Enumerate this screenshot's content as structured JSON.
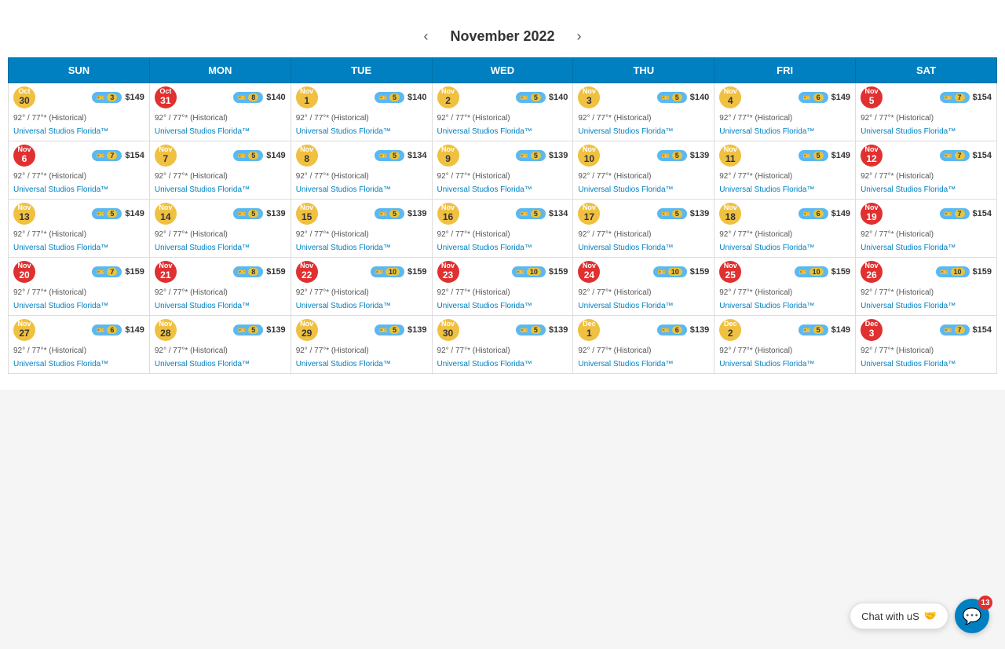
{
  "calendar": {
    "title": "November 2022",
    "days_of_week": [
      "SUN",
      "MON",
      "TUE",
      "WED",
      "THU",
      "FRI",
      "SAT"
    ],
    "prev_label": "‹",
    "next_label": "›"
  },
  "rows": [
    {
      "cells": [
        {
          "month": "Oct",
          "day": "30",
          "crowd": 3,
          "crowd_color": "yellow",
          "ticket": true,
          "price": "$149",
          "weather": "92° / 77°* (Historical)",
          "link": "Universal Studios Florida™",
          "highlight": false
        },
        {
          "month": "Oct",
          "day": "31",
          "crowd": 8,
          "crowd_color": "red",
          "ticket": true,
          "price": "$140",
          "weather": "92° / 77°* (Historical)",
          "link": "Universal Studios Florida™",
          "highlight": false
        },
        {
          "month": "Nov",
          "day": "1",
          "crowd": 5,
          "crowd_color": "yellow",
          "ticket": true,
          "price": "$140",
          "weather": "92° / 77°* (Historical)",
          "link": "Universal Studios Florida™",
          "highlight": false
        },
        {
          "month": "Nov",
          "day": "2",
          "crowd": 5,
          "crowd_color": "yellow",
          "ticket": true,
          "price": "$140",
          "weather": "92° / 77°* (Historical)",
          "link": "Universal Studios Florida™",
          "highlight": false
        },
        {
          "month": "Nov",
          "day": "3",
          "crowd": 5,
          "crowd_color": "yellow",
          "ticket": true,
          "price": "$140",
          "weather": "92° / 77°* (Historical)",
          "link": "Universal Studios Florida™",
          "highlight": true
        },
        {
          "month": "Nov",
          "day": "4",
          "crowd": 6,
          "crowd_color": "yellow",
          "ticket": true,
          "price": "$149",
          "weather": "92° / 77°* (Historical)",
          "link": "Universal Studios Florida™",
          "highlight": false
        },
        {
          "month": "Nov",
          "day": "5",
          "crowd": 7,
          "crowd_color": "red",
          "ticket": true,
          "price": "$154",
          "weather": "92° / 77°* (Historical)",
          "link": "Universal Studios Florida™",
          "highlight": false
        }
      ]
    },
    {
      "cells": [
        {
          "month": "Nov",
          "day": "6",
          "crowd": 7,
          "crowd_color": "red",
          "ticket": true,
          "price": "$154",
          "weather": "92° / 77°* (Historical)",
          "link": "Universal Studios Florida™",
          "highlight": false
        },
        {
          "month": "Nov",
          "day": "7",
          "crowd": 5,
          "crowd_color": "yellow",
          "ticket": true,
          "price": "$149",
          "weather": "92° / 77°* (Historical)",
          "link": "Universal Studios Florida™",
          "highlight": false
        },
        {
          "month": "Nov",
          "day": "8",
          "crowd": 5,
          "crowd_color": "yellow",
          "ticket": true,
          "price": "$134",
          "weather": "92° / 77°* (Historical)",
          "link": "Universal Studios Florida™",
          "highlight": false
        },
        {
          "month": "Nov",
          "day": "9",
          "crowd": 5,
          "crowd_color": "yellow",
          "ticket": true,
          "price": "$139",
          "weather": "92° / 77°* (Historical)",
          "link": "Universal Studios Florida™",
          "highlight": false
        },
        {
          "month": "Nov",
          "day": "10",
          "crowd": 5,
          "crowd_color": "yellow",
          "ticket": true,
          "price": "$139",
          "weather": "92° / 77°* (Historical)",
          "link": "Universal Studios Florida™",
          "highlight": false
        },
        {
          "month": "Nov",
          "day": "11",
          "crowd": 5,
          "crowd_color": "yellow",
          "ticket": true,
          "price": "$149",
          "weather": "92° / 77°* (Historical)",
          "link": "Universal Studios Florida™",
          "highlight": false
        },
        {
          "month": "Nov",
          "day": "12",
          "crowd": 7,
          "crowd_color": "red",
          "ticket": true,
          "price": "$154",
          "weather": "92° / 77°* (Historical)",
          "link": "Universal Studios Florida™",
          "highlight": false
        }
      ]
    },
    {
      "cells": [
        {
          "month": "Nov",
          "day": "13",
          "crowd": 5,
          "crowd_color": "yellow",
          "ticket": true,
          "price": "$149",
          "weather": "92° / 77°* (Historical)",
          "link": "Universal Studios Florida™",
          "highlight": false
        },
        {
          "month": "Nov",
          "day": "14",
          "crowd": 5,
          "crowd_color": "yellow",
          "ticket": true,
          "price": "$139",
          "weather": "92° / 77°* (Historical)",
          "link": "Universal Studios Florida™",
          "highlight": false
        },
        {
          "month": "Nov",
          "day": "15",
          "crowd": 5,
          "crowd_color": "yellow",
          "ticket": true,
          "price": "$139",
          "weather": "92° / 77°* (Historical)",
          "link": "Universal Studios Florida™",
          "highlight": false
        },
        {
          "month": "Nov",
          "day": "16",
          "crowd": 5,
          "crowd_color": "yellow",
          "ticket": true,
          "price": "$134",
          "weather": "92° / 77°* (Historical)",
          "link": "Universal Studios Florida™",
          "highlight": false
        },
        {
          "month": "Nov",
          "day": "17",
          "crowd": 5,
          "crowd_color": "yellow",
          "ticket": true,
          "price": "$139",
          "weather": "92° / 77°* (Historical)",
          "link": "Universal Studios Florida™",
          "highlight": false
        },
        {
          "month": "Nov",
          "day": "18",
          "crowd": 6,
          "crowd_color": "yellow",
          "ticket": true,
          "price": "$149",
          "weather": "92° / 77°* (Historical)",
          "link": "Universal Studios Florida™",
          "highlight": false
        },
        {
          "month": "Nov",
          "day": "19",
          "crowd": 7,
          "crowd_color": "red",
          "ticket": true,
          "price": "$154",
          "weather": "92° / 77°* (Historical)",
          "link": "Universal Studios Florida™",
          "highlight": false
        }
      ]
    },
    {
      "cells": [
        {
          "month": "Nov",
          "day": "20",
          "crowd": 7,
          "crowd_color": "red",
          "ticket": true,
          "price": "$159",
          "weather": "92° / 77°* (Historical)",
          "link": "Universal Studios Florida™",
          "highlight": false
        },
        {
          "month": "Nov",
          "day": "21",
          "crowd": 8,
          "crowd_color": "red",
          "ticket": true,
          "price": "$159",
          "weather": "92° / 77°* (Historical)",
          "link": "Universal Studios Florida™",
          "highlight": false
        },
        {
          "month": "Nov",
          "day": "22",
          "crowd": 10,
          "crowd_color": "red",
          "ticket": true,
          "price": "$159",
          "weather": "92° / 77°* (Historical)",
          "link": "Universal Studios Florida™",
          "highlight": false
        },
        {
          "month": "Nov",
          "day": "23",
          "crowd": 10,
          "crowd_color": "red",
          "ticket": true,
          "price": "$159",
          "weather": "92° / 77°* (Historical)",
          "link": "Universal Studios Florida™",
          "highlight": false
        },
        {
          "month": "Nov",
          "day": "24",
          "crowd": 10,
          "crowd_color": "red",
          "ticket": true,
          "price": "$159",
          "weather": "92° / 77°* (Historical)",
          "link": "Universal Studios Florida™",
          "highlight": false
        },
        {
          "month": "Nov",
          "day": "25",
          "crowd": 10,
          "crowd_color": "red",
          "ticket": true,
          "price": "$159",
          "weather": "92° / 77°* (Historical)",
          "link": "Universal Studios Florida™",
          "highlight": false
        },
        {
          "month": "Nov",
          "day": "26",
          "crowd": 10,
          "crowd_color": "red",
          "ticket": true,
          "price": "$159",
          "weather": "92° / 77°* (Historical)",
          "link": "Universal Studios Florida™",
          "highlight": false
        }
      ]
    },
    {
      "cells": [
        {
          "month": "Nov",
          "day": "27",
          "crowd": 6,
          "crowd_color": "yellow",
          "ticket": true,
          "price": "$149",
          "weather": "92° / 77°* (Historical)",
          "link": "Universal Studios Florida™",
          "highlight": false
        },
        {
          "month": "Nov",
          "day": "28",
          "crowd": 5,
          "crowd_color": "yellow",
          "ticket": true,
          "price": "$139",
          "weather": "92° / 77°* (Historical)",
          "link": "Universal Studios Florida™",
          "highlight": false
        },
        {
          "month": "Nov",
          "day": "29",
          "crowd": 5,
          "crowd_color": "yellow",
          "ticket": true,
          "price": "$139",
          "weather": "92° / 77°* (Historical)",
          "link": "Universal Studios Florida™",
          "highlight": false
        },
        {
          "month": "Nov",
          "day": "30",
          "crowd": 5,
          "crowd_color": "yellow",
          "ticket": true,
          "price": "$139",
          "weather": "92° / 77°* (Historical)",
          "link": "Universal Studios Florida™",
          "highlight": false
        },
        {
          "month": "Dec",
          "day": "1",
          "crowd": 6,
          "crowd_color": "yellow",
          "ticket": true,
          "price": "$139",
          "weather": "92° / 77°* (Historical)",
          "link": "Universal Studios Florida™",
          "highlight": false
        },
        {
          "month": "Dec",
          "day": "2",
          "crowd": 5,
          "crowd_color": "yellow",
          "ticket": true,
          "price": "$149",
          "weather": "92° / 77°* (Historical)",
          "link": "Universal Studios Florida™",
          "highlight": false
        },
        {
          "month": "Dec",
          "day": "3",
          "crowd": 7,
          "crowd_color": "red",
          "ticket": true,
          "price": "$154",
          "weather": "92° / 77°* (Historical)",
          "link": "Universal Studios Florida™",
          "highlight": false
        }
      ]
    }
  ],
  "chat": {
    "label": "Chat with uS",
    "emoji": "💬",
    "notification_count": "13"
  }
}
